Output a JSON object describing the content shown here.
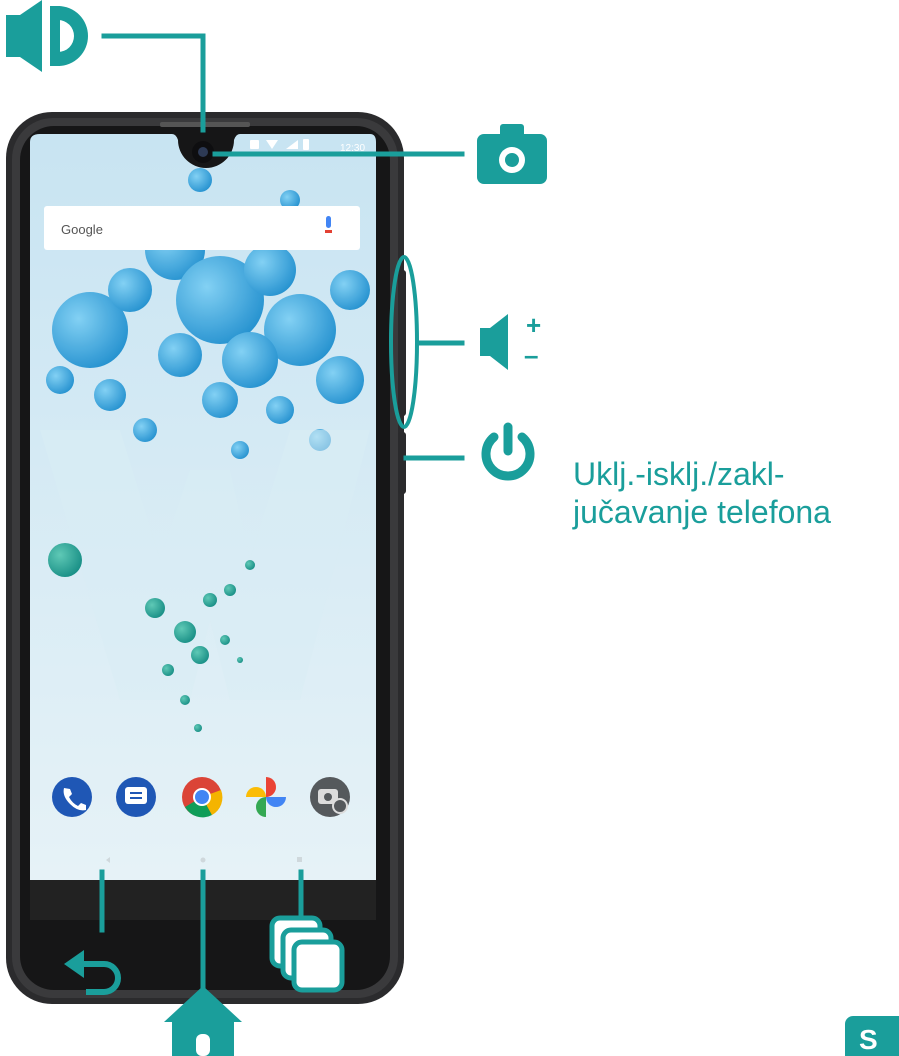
{
  "diagram": {
    "accent_color": "#1a9e9b",
    "power_label_line1": "Uklj.-isklj./zakl-",
    "power_label_line2": "jučavanje telefona",
    "volume_plus": "+",
    "volume_minus": "–",
    "badge_text": "S"
  },
  "phone": {
    "search_text": "Google",
    "status_time": "12:30",
    "dock_icons": [
      "phone-icon",
      "messages-icon",
      "chrome-icon",
      "photos-icon",
      "camera-app-icon"
    ]
  },
  "callouts": [
    "speaker-icon",
    "camera-icon",
    "volume-icon",
    "power-icon",
    "back-icon",
    "home-icon",
    "recent-apps-icon"
  ]
}
